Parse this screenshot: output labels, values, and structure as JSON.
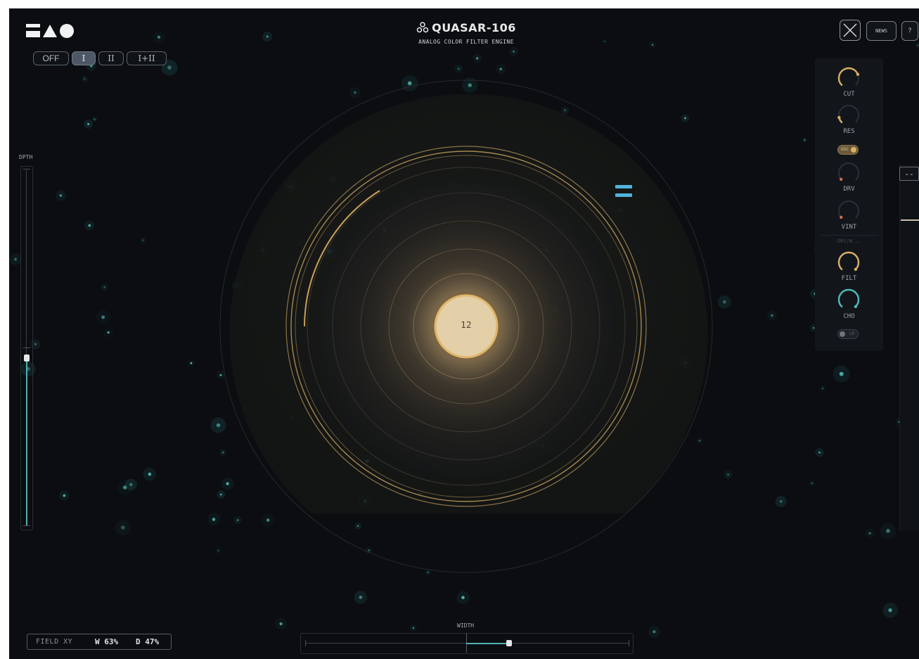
{
  "app": {
    "title": "QUASAR-106",
    "subtitle": "ANALOG COLOR FILTER ENGINE"
  },
  "mode_buttons": [
    {
      "label": "OFF",
      "active": false
    },
    {
      "label": "I",
      "active": true
    },
    {
      "label": "II",
      "active": false
    },
    {
      "label": "I+II",
      "active": false
    }
  ],
  "top_right": {
    "news_label": "NEWS",
    "help_label": "?"
  },
  "depth": {
    "label": "DPTH",
    "value": 0.47
  },
  "visualizer": {
    "core_value": "12",
    "accent_color": "#d7ad63",
    "marker_color": "#4fb4dc"
  },
  "knobs": [
    {
      "label": "CUT",
      "value": 0.75,
      "color": "#d7ad63"
    },
    {
      "label": "RES",
      "value": 0.12,
      "color": "#d7ad63"
    },
    {
      "label": "DRV",
      "value": 0.02,
      "color": "#c8724a"
    },
    {
      "label": "VINT",
      "value": 0.02,
      "color": "#c8724a"
    },
    {
      "label": "FILT",
      "value": 1.0,
      "color": "#d7ad63"
    },
    {
      "label": "CHO",
      "value": 1.0,
      "color": "#4fb8b8"
    }
  ],
  "toggles": {
    "osc": {
      "label": "OSC",
      "on": true
    },
    "ld": {
      "label": "LD",
      "on": false
    }
  },
  "dry_wet_label": "DRY/W...",
  "edge_readout": "--",
  "width": {
    "label": "WIDTH",
    "value": 0.63
  },
  "field": {
    "label": "FIELD XY",
    "w": "W 63%",
    "d": "D 47%"
  },
  "colors": {
    "background": "#0b0d11",
    "teal": "#4fb0b0",
    "gold": "#d7ad63"
  }
}
